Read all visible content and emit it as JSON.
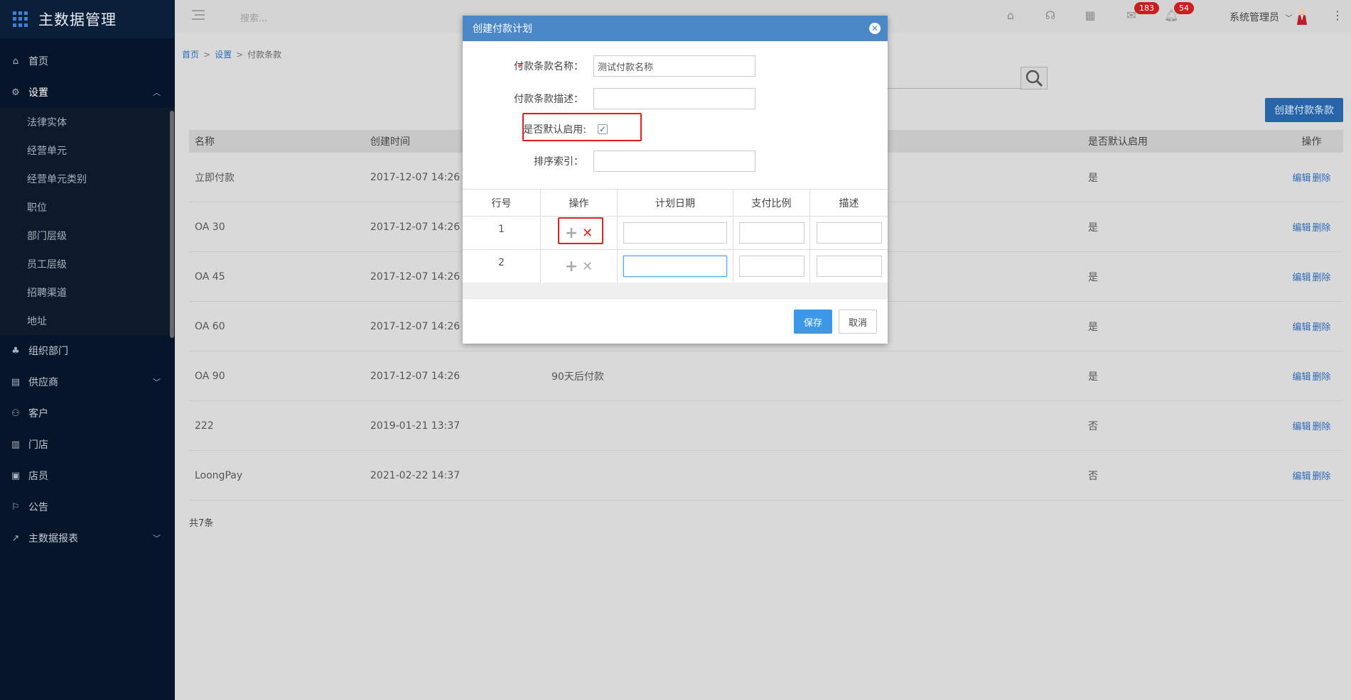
{
  "app": {
    "title": "主数据管理"
  },
  "sidebar": {
    "items": [
      {
        "label": "首页",
        "icon": "home-icon"
      },
      {
        "label": "设置",
        "icon": "gear-icon"
      },
      {
        "label": "组织部门",
        "icon": "org-icon"
      },
      {
        "label": "供应商",
        "icon": "supplier-icon"
      },
      {
        "label": "客户",
        "icon": "customer-icon"
      },
      {
        "label": "门店",
        "icon": "store-icon"
      },
      {
        "label": "店员",
        "icon": "clerk-icon"
      },
      {
        "label": "公告",
        "icon": "announcement-icon"
      },
      {
        "label": "主数据报表",
        "icon": "report-icon"
      }
    ],
    "settings_sub": [
      "法律实体",
      "经营单元",
      "经营单元类别",
      "职位",
      "部门层级",
      "员工层级",
      "招聘渠道",
      "地址"
    ]
  },
  "header": {
    "search_placeholder": "搜索...",
    "badge_messages": "183",
    "badge_notifications": "54",
    "user": "系统管理员"
  },
  "breadcrumb": {
    "home": "首页",
    "settings": "设置",
    "current": "付款条款"
  },
  "toolbar": {
    "create_label": "创建付款条款"
  },
  "table": {
    "columns": [
      "名称",
      "创建时间",
      "",
      "是否默认启用",
      "操作"
    ],
    "rows": [
      {
        "name": "立即付款",
        "created": "2017-12-07 14:26",
        "desc": "",
        "default": "是"
      },
      {
        "name": "OA 30",
        "created": "2017-12-07 14:26",
        "desc": "",
        "default": "是"
      },
      {
        "name": "OA 45",
        "created": "2017-12-07 14:26",
        "desc": "",
        "default": "是"
      },
      {
        "name": "OA 60",
        "created": "2017-12-07 14:26",
        "desc": "",
        "default": "是"
      },
      {
        "name": "OA 90",
        "created": "2017-12-07 14:26",
        "desc": "90天后付款",
        "default": "是"
      },
      {
        "name": "222",
        "created": "2019-01-21 13:37",
        "desc": "",
        "default": "否"
      },
      {
        "name": "LoongPay",
        "created": "2021-02-22 14:37",
        "desc": "",
        "default": "否"
      }
    ],
    "edit_label": "编辑",
    "delete_label": "删除",
    "total": "共7条"
  },
  "modal": {
    "title": "创建付款计划",
    "name_label": "付款条款名称：",
    "name_value": "测试付款名称",
    "desc_label": "付款条款描述：",
    "desc_value": "",
    "default_label": "是否默认启用:",
    "default_checked": true,
    "sort_label": "排序索引：",
    "sort_value": "",
    "grid_columns": [
      "行号",
      "操作",
      "计划日期",
      "支付比例",
      "描述"
    ],
    "grid_rows": [
      "1",
      "2"
    ],
    "save_label": "保存",
    "cancel_label": "取消"
  },
  "colors": {
    "sidebar_bg": "#061529",
    "accent": "#3b99e8",
    "modal_header": "#4b88c8",
    "highlight": "#e02020",
    "link": "#2d6bb8"
  }
}
